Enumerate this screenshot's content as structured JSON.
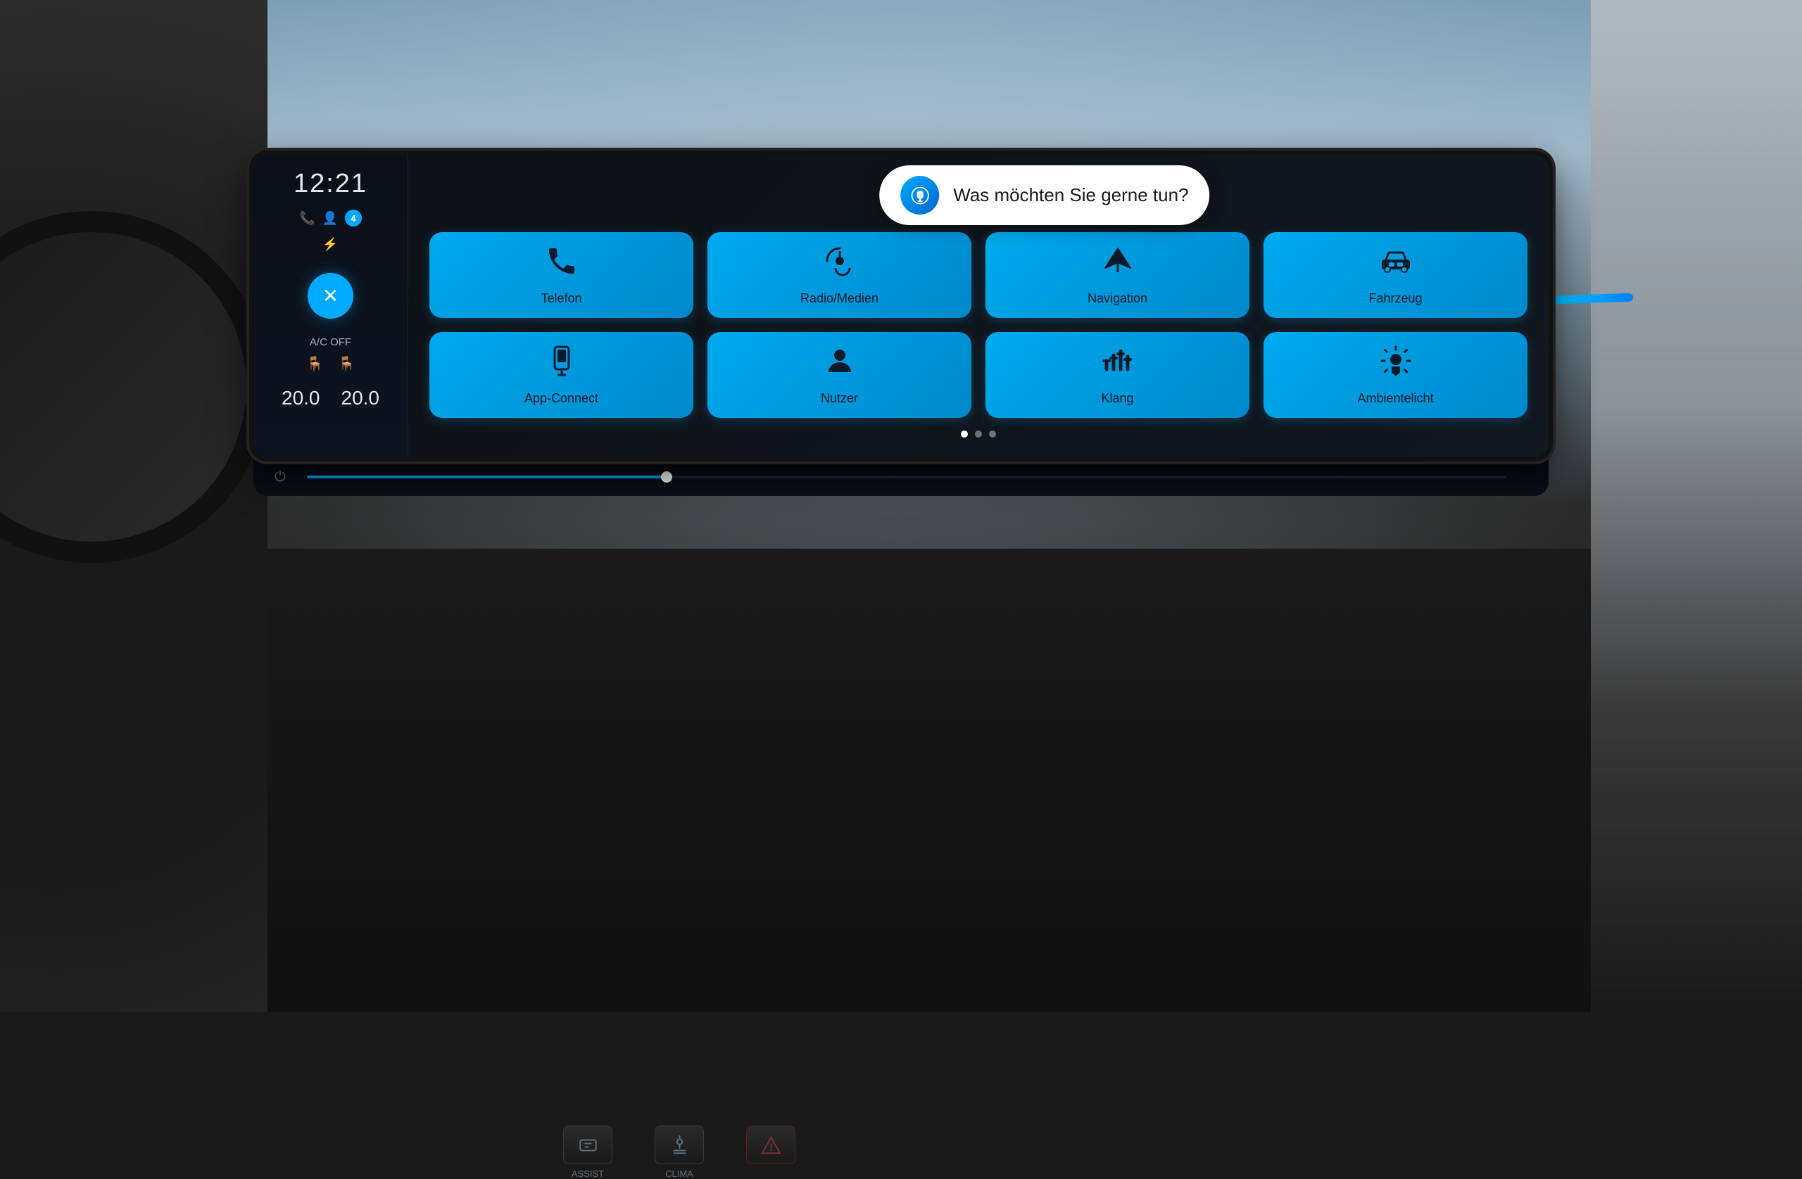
{
  "environment": {
    "bg_description": "VW car interior dashboard view"
  },
  "climate_panel": {
    "time": "12:21",
    "notification_count": "4",
    "wireless_charging": true,
    "close_button_label": "✕",
    "ac_label": "A/C OFF",
    "temp_left": "20.0",
    "temp_right": "20.0"
  },
  "voice_assistant": {
    "prompt_text": "Was möchten Sie gerne tun?"
  },
  "app_grid": {
    "items": [
      {
        "id": "telefon",
        "label": "Telefon",
        "icon": "phone"
      },
      {
        "id": "radio-medien",
        "label": "Radio/Medien",
        "icon": "music"
      },
      {
        "id": "navigation",
        "label": "Navigation",
        "icon": "nav"
      },
      {
        "id": "fahrzeug",
        "label": "Fahrzeug",
        "icon": "car"
      },
      {
        "id": "app-connect",
        "label": "App-Connect",
        "icon": "phone-mirror"
      },
      {
        "id": "nutzer",
        "label": "Nutzer",
        "icon": "person"
      },
      {
        "id": "klang",
        "label": "Klang",
        "icon": "equalizer"
      },
      {
        "id": "ambientelicht",
        "label": "Ambientelicht",
        "icon": "bulb"
      }
    ],
    "page_dots": [
      {
        "active": true
      },
      {
        "active": false
      },
      {
        "active": false
      }
    ]
  },
  "bottom_controls": {
    "power_label": "⏻",
    "volume_slider_pct": 30
  },
  "physical_buttons": [
    {
      "id": "assist",
      "label": "ASSIST",
      "icon": "🚗"
    },
    {
      "id": "clima",
      "label": "CLIMA",
      "icon": "❄"
    },
    {
      "id": "hazard",
      "label": "",
      "icon": "⚠"
    }
  ],
  "colors": {
    "accent_blue": "#00aaee",
    "text_primary": "#e0e8f0",
    "text_secondary": "#a0b0c0",
    "tile_bg": "#00aaee",
    "screen_bg": "#0d1117"
  }
}
